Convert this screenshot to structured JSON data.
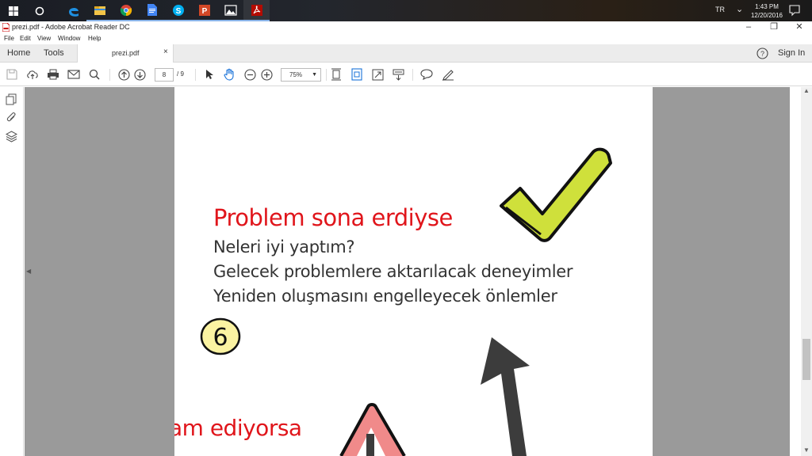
{
  "taskbar": {
    "apps": [
      {
        "icon": "windows-start-icon"
      },
      {
        "icon": "cortana-icon"
      },
      {
        "icon": "edge-icon"
      },
      {
        "icon": "file-explorer-icon"
      },
      {
        "icon": "chrome-icon"
      },
      {
        "icon": "google-docs-icon"
      },
      {
        "icon": "skype-icon"
      },
      {
        "icon": "powerpoint-icon"
      },
      {
        "icon": "photos-icon"
      },
      {
        "icon": "acrobat-icon"
      }
    ],
    "language": "TR",
    "time": "1:43 PM",
    "date": "12/20/2016"
  },
  "window": {
    "title": "prezi.pdf - Adobe Acrobat Reader DC"
  },
  "menu": {
    "file": "File",
    "edit": "Edit",
    "view": "View",
    "window": "Window",
    "help": "Help"
  },
  "tabs": {
    "home": "Home",
    "tools": "Tools",
    "document": "prezi.pdf",
    "close": "×",
    "sign_in": "Sign In"
  },
  "toolbar": {
    "current_page": "8",
    "page_count": "/ 9",
    "zoom": "75%"
  },
  "page": {
    "heading": "Problem sona erdiyse",
    "lines": [
      "Neleri iyi yaptım?",
      "Gelecek problemlere aktarılacak deneyimler",
      "Yeniden oluşmasını engelleyecek önlemler"
    ],
    "number": "6",
    "bottom_text": "am ediyorsa"
  },
  "colors": {
    "accent_red": "#e0151b",
    "check_green": "#cfe03b",
    "badge_yellow": "#fbf3a2",
    "warning_pink": "#f08a8a"
  }
}
